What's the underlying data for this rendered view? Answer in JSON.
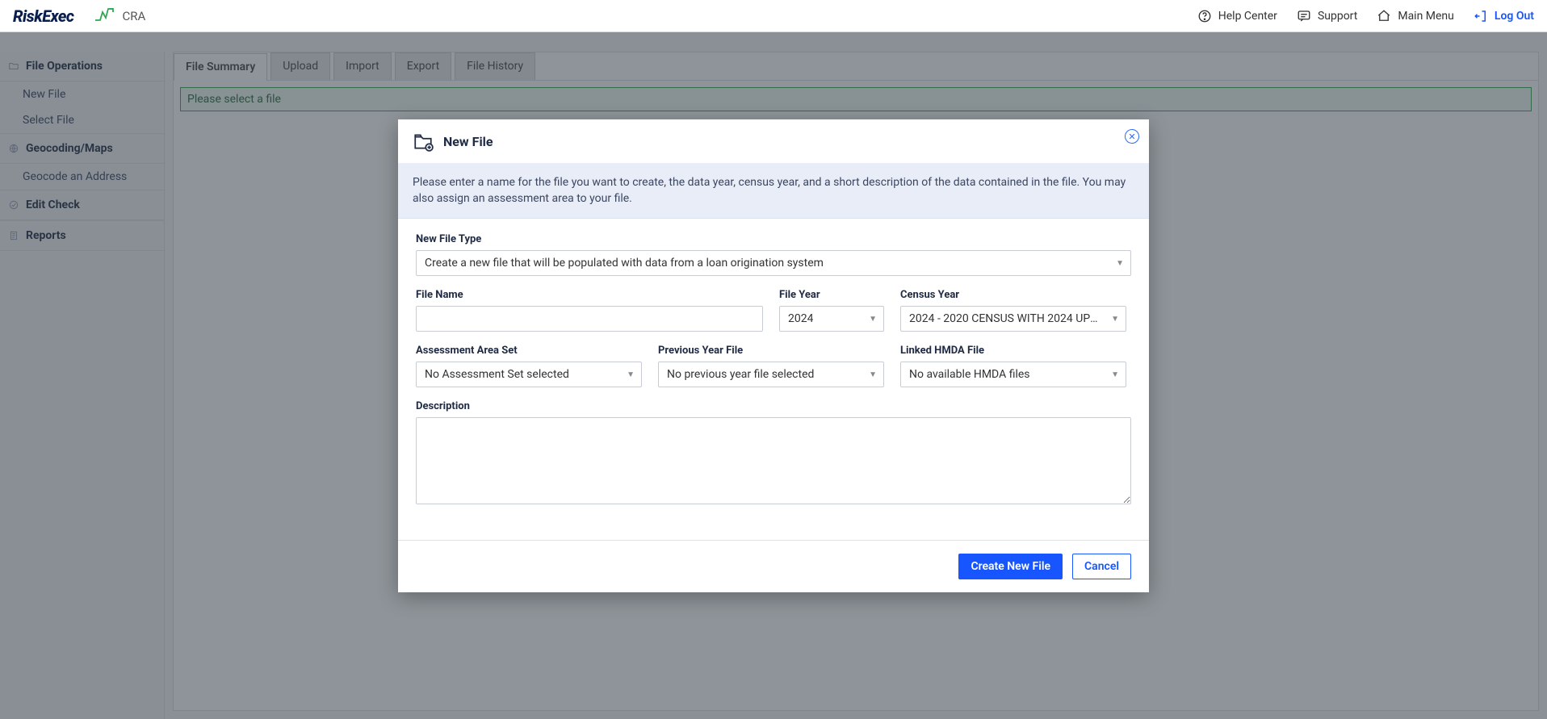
{
  "topbar": {
    "logo_text": "RiskExec",
    "module_name": "CRA",
    "links": {
      "help": "Help Center",
      "support": "Support",
      "main_menu": "Main Menu",
      "logout": "Log Out"
    }
  },
  "sidebar": {
    "sections": [
      {
        "title": "File Operations",
        "items": [
          "New File",
          "Select File"
        ]
      },
      {
        "title": "Geocoding/Maps",
        "items": [
          "Geocode an Address"
        ]
      },
      {
        "title": "Edit Check",
        "items": []
      },
      {
        "title": "Reports",
        "items": []
      }
    ]
  },
  "tabs": {
    "items": [
      "File Summary",
      "Upload",
      "Import",
      "Export",
      "File History"
    ],
    "active_index": 0
  },
  "content": {
    "prompt": "Please select a file"
  },
  "modal": {
    "title": "New File",
    "info": "Please enter a name for the file you want to create, the data year, census year, and a short description of the data contained in the file.  You may also assign an assessment area to your file.",
    "labels": {
      "new_file_type": "New File Type",
      "file_name": "File Name",
      "file_year": "File Year",
      "census_year": "Census Year",
      "assessment_set": "Assessment Area Set",
      "prev_year_file": "Previous Year File",
      "linked_hmda": "Linked HMDA File",
      "description": "Description"
    },
    "values": {
      "new_file_type": "Create a new file that will be populated with data from a loan origination system",
      "file_name": "",
      "file_year": "2024",
      "census_year": "2024 - 2020 CENSUS WITH 2024 UPDA…",
      "assessment_set": "No Assessment Set selected",
      "prev_year_file": "No previous year file selected",
      "linked_hmda": "No available HMDA files",
      "description": ""
    },
    "buttons": {
      "create": "Create New File",
      "cancel": "Cancel"
    }
  }
}
